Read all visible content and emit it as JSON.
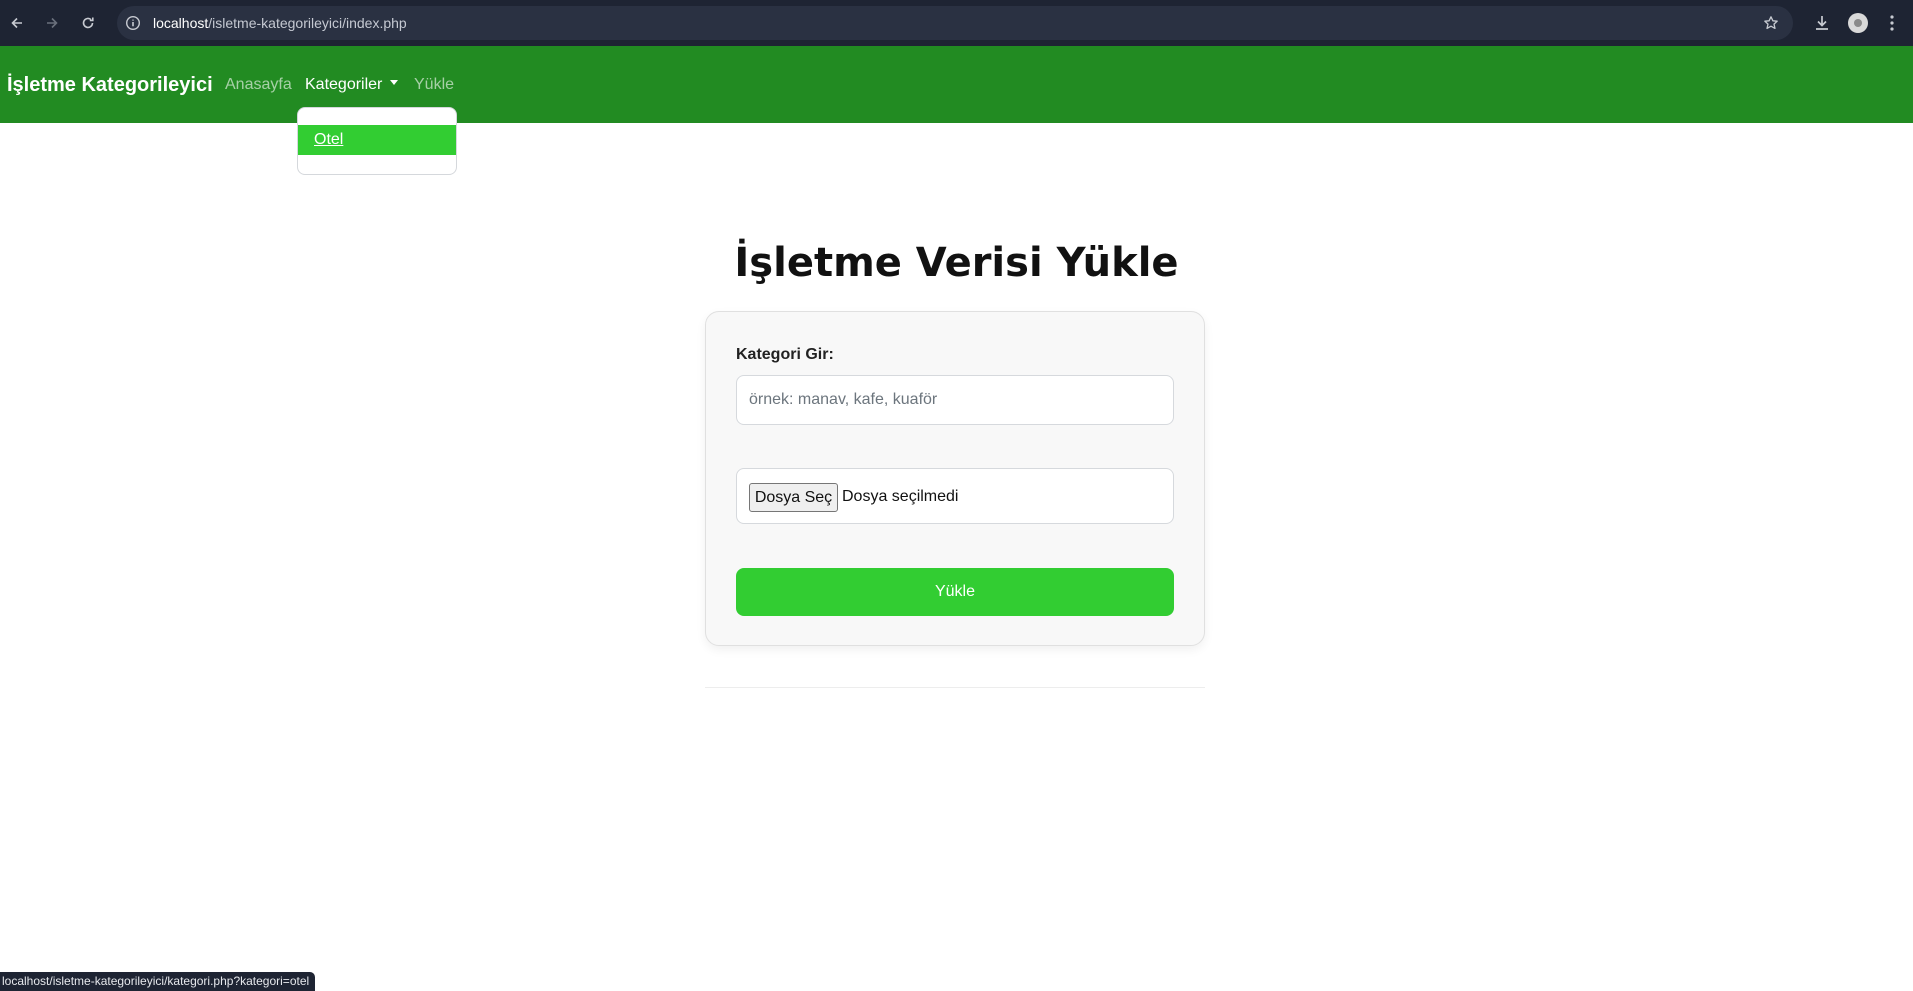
{
  "browser": {
    "url_host": "localhost",
    "url_path": "/isletme-kategorileyici/index.php",
    "status_url": "localhost/isletme-kategorileyici/kategori.php?kategori=otel"
  },
  "navbar": {
    "brand": "İşletme Kategorileyici",
    "links": [
      {
        "label": "Anasayfa"
      },
      {
        "label": "Kategoriler"
      },
      {
        "label": "Yükle"
      }
    ],
    "dropdown_items": [
      {
        "label": "Otel"
      }
    ],
    "colors": {
      "navbar_bg": "#228b22",
      "accent": "#32cd32"
    }
  },
  "main": {
    "title": "İşletme Verisi Yükle",
    "form": {
      "category_label": "Kategori Gir:",
      "category_placeholder": "örnek: manav, kafe, kuaför",
      "category_value": "",
      "file_button": "Dosya Seç",
      "file_status": "Dosya seçilmedi",
      "submit_label": "Yükle"
    }
  }
}
